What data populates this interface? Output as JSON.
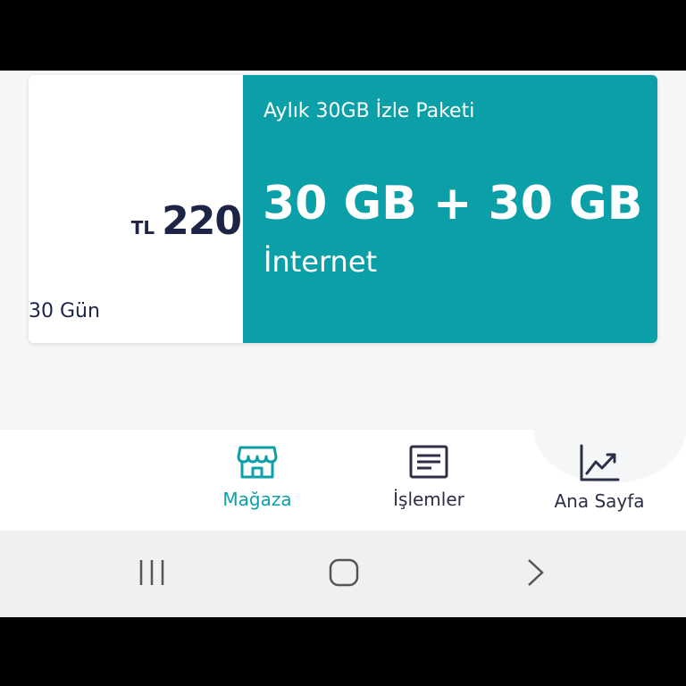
{
  "package_card": {
    "currency": "TL",
    "price": "220",
    "duration": "30 Gün",
    "name": "Aylık 30GB İzle Paketi",
    "amount": "30 GB + 30 GB",
    "type": "İnternet"
  },
  "bottom_nav": {
    "items": [
      {
        "label": "Mağaza",
        "icon": "store-icon",
        "active": true
      },
      {
        "label": "İşlemler",
        "icon": "list-icon",
        "active": false
      },
      {
        "label": "Ana Sayfa",
        "icon": "chart-icon",
        "active": false
      }
    ]
  },
  "system_nav": {
    "buttons": [
      "recent-apps-icon",
      "home-icon",
      "back-icon"
    ]
  },
  "colors": {
    "accent": "#0b9fa8",
    "text_dark": "#1d2445"
  }
}
